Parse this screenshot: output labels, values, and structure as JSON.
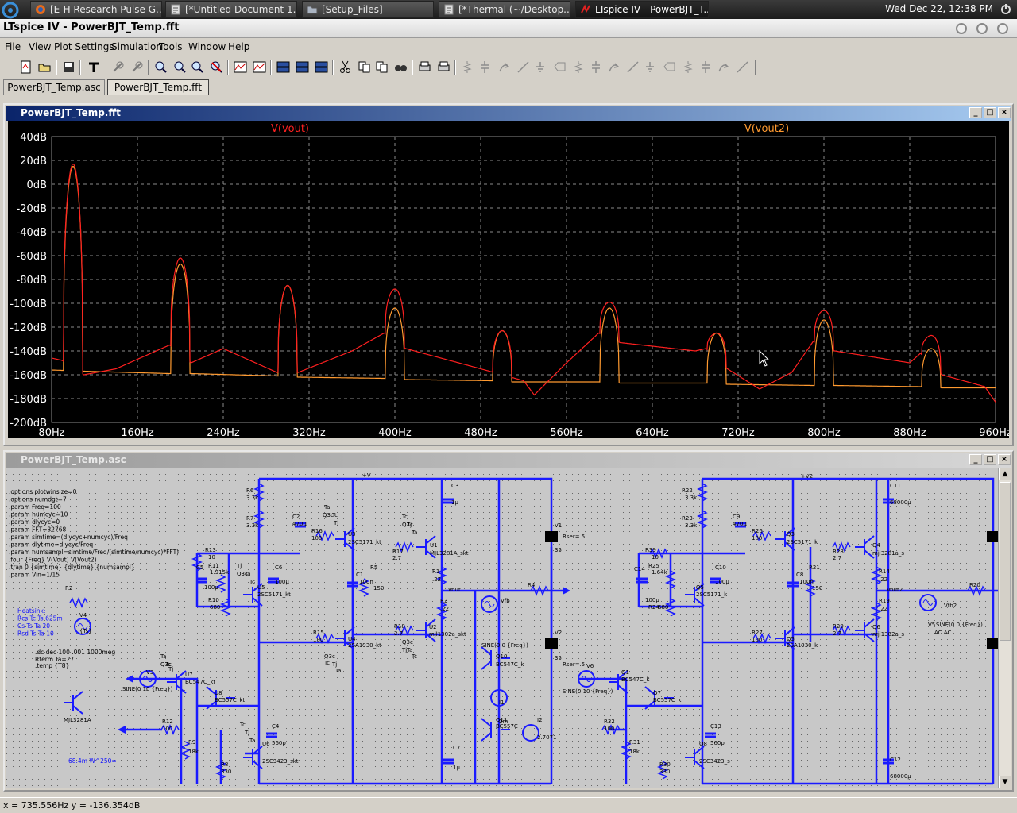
{
  "taskbar": {
    "tasks": [
      {
        "label": "[E-H Research Pulse G...",
        "icon": "firefox-icon"
      },
      {
        "label": "[*Untitled Document 1...",
        "icon": "text-editor-icon"
      },
      {
        "label": "[Setup_Files]",
        "icon": "folder-icon"
      },
      {
        "label": "[*Thermal (~/Desktop...",
        "icon": "text-editor-icon"
      },
      {
        "label": "LTspice IV - PowerBJT_T...",
        "icon": "ltspice-icon"
      }
    ],
    "clock": "Wed Dec 22, 12:38 PM"
  },
  "app": {
    "title": "LTspice IV - PowerBJT_Temp.fft"
  },
  "menu": [
    "File",
    "View",
    "Plot Settings",
    "Simulation",
    "Tools",
    "Window",
    "Help"
  ],
  "toolbar": {
    "buttons": [
      "new-schematic-icon",
      "open-icon",
      "save-icon",
      "control-panel-icon",
      "run-icon",
      "pan-icon",
      "zoom-in-icon",
      "zoom-fit-icon",
      "zoom-out-icon",
      "zoom-cancel-icon",
      "autorange-icon",
      "autorange-all-icon",
      "tile-horizontal-icon",
      "cascade-icon",
      "tile-windows-icon",
      "cut-icon",
      "copy-icon",
      "paste-icon",
      "find-icon",
      "print-setup-icon",
      "print-icon",
      "wire-icon",
      "ground-icon",
      "label-net-icon",
      "resistor-icon",
      "capacitor-icon",
      "inductor-icon",
      "diode-icon",
      "component-icon",
      "move-icon",
      "drag-icon",
      "undo-icon",
      "redo-icon",
      "rotate-icon",
      "mirror-icon",
      "text-icon",
      "spice-directive-icon"
    ]
  },
  "doc_tabs": [
    {
      "label": "PowerBJT_Temp.asc",
      "active": false
    },
    {
      "label": "PowerBJT_Temp.fft",
      "active": true
    }
  ],
  "plot_window": {
    "title": "PowerBJT_Temp.fft"
  },
  "schematic_window": {
    "title": "PowerBJT_Temp.asc"
  },
  "status": {
    "coords": "x = 735.556Hz    y = -136.354dB"
  },
  "colors": {
    "trace1": "#ff2020",
    "trace2": "#ff9a30",
    "wire": "#1a1aff",
    "grid": "#8a8a8a"
  },
  "chart_data": {
    "type": "line",
    "series": [
      {
        "name": "V(vout)",
        "color": "#ff2020",
        "peaks": [
          [
            100,
            17
          ],
          [
            200,
            -62
          ],
          [
            300,
            -85
          ],
          [
            400,
            -88
          ],
          [
            500,
            -123
          ],
          [
            600,
            -99
          ],
          [
            700,
            -125
          ],
          [
            800,
            -106
          ],
          [
            900,
            -127
          ]
        ],
        "floor": [
          [
            80,
            -146
          ],
          [
            90,
            -148
          ],
          [
            110,
            -160
          ],
          [
            140,
            -155
          ],
          [
            190,
            -135
          ],
          [
            210,
            -150
          ],
          [
            240,
            -138
          ],
          [
            290,
            -158
          ],
          [
            310,
            -158
          ],
          [
            360,
            -140
          ],
          [
            390,
            -125
          ],
          [
            410,
            -138
          ],
          [
            480,
            -155
          ],
          [
            520,
            -165
          ],
          [
            530,
            -177
          ],
          [
            560,
            -150
          ],
          [
            590,
            -125
          ],
          [
            610,
            -133
          ],
          [
            680,
            -140
          ],
          [
            690,
            -138
          ],
          [
            710,
            -155
          ],
          [
            740,
            -172
          ],
          [
            770,
            -158
          ],
          [
            790,
            -132
          ],
          [
            810,
            -140
          ],
          [
            880,
            -150
          ],
          [
            890,
            -142
          ],
          [
            910,
            -160
          ],
          [
            950,
            -170
          ],
          [
            960,
            -183
          ]
        ]
      },
      {
        "name": "V(vout2)",
        "color": "#ff9a30",
        "peaks": [
          [
            100,
            15
          ],
          [
            200,
            -67
          ],
          [
            300,
            -85
          ],
          [
            400,
            -104
          ],
          [
            500,
            -123
          ],
          [
            600,
            -104
          ],
          [
            700,
            -125
          ],
          [
            800,
            -114
          ],
          [
            900,
            -138
          ]
        ],
        "floor": [
          [
            80,
            -156
          ],
          [
            110,
            -157
          ],
          [
            190,
            -159
          ],
          [
            210,
            -159
          ],
          [
            290,
            -161
          ],
          [
            310,
            -162
          ],
          [
            390,
            -163
          ],
          [
            410,
            -164
          ],
          [
            490,
            -165
          ],
          [
            510,
            -166
          ],
          [
            590,
            -166
          ],
          [
            610,
            -167
          ],
          [
            690,
            -167
          ],
          [
            710,
            -168
          ],
          [
            790,
            -169
          ],
          [
            810,
            -169
          ],
          [
            890,
            -170
          ],
          [
            910,
            -171
          ],
          [
            950,
            -171
          ]
        ]
      }
    ],
    "xlabel": "",
    "ylabel": "",
    "xlim": [
      80,
      960
    ],
    "ylim": [
      -200,
      40
    ],
    "xticks": [
      "80Hz",
      "160Hz",
      "240Hz",
      "320Hz",
      "400Hz",
      "480Hz",
      "560Hz",
      "640Hz",
      "720Hz",
      "800Hz",
      "880Hz",
      "960Hz"
    ],
    "yticks": [
      "40dB",
      "20dB",
      "0dB",
      "-20dB",
      "-40dB",
      "-60dB",
      "-80dB",
      "-100dB",
      "-120dB",
      "-140dB",
      "-160dB",
      "-180dB",
      "-200dB"
    ],
    "grid": true
  },
  "schematic": {
    "directives": [
      ".options plotwinsize=0",
      ".options numdgt=7",
      ".param Freq=100",
      ".param numcyc=10",
      ".param dlycyc=0",
      ".param FFT=32768",
      ".param simtime=(dlycyc+numcyc)/Freq",
      ".param dlytime=dlycyc/Freq",
      ".param numsampl=simtime/Freq/(simtime/numcyc)*FFT)",
      ".four {Freq} V(Vout) V(Vout2)",
      ".tran 0 {simtime} {dlytime} {numsampl}",
      ".param Vin=1/15"
    ],
    "heatsink": [
      "Heatsink:",
      "Rcs Tc Ts 625m",
      "Cs Ts Ta 20",
      "Rsd Ts Ta 10"
    ],
    "misc": [
      ".dc dec 100 .001 1000meg",
      "Rterm Ta=27",
      ".temp {T8}",
      "68.4m W^250="
    ],
    "labels_left": [
      "R6",
      "3.3k",
      "R7",
      "3.3k",
      "C2",
      "470μ",
      "R16",
      "100",
      "R13",
      "10",
      "R11",
      "1.915k",
      "C5",
      "100μ",
      "R10",
      "680",
      "C6",
      "100μ",
      "U5",
      "2SC5171_kt",
      "U3",
      "2SC5171_kt",
      "R17",
      "2.7",
      "U1",
      "MJL3281A_skt",
      "R1",
      ".22",
      "Vout",
      "R4",
      "C1",
      "100n",
      "R5",
      "150",
      "R3",
      ".22",
      "R18",
      "2.7",
      "U2",
      "mjl1302a_skt",
      "U4",
      "2SA1930_kt",
      "R15",
      "100",
      "C3",
      "1μ",
      "V1",
      "35",
      "V2",
      "35",
      "Rser=.5",
      "R2",
      "R12",
      "100",
      "R9",
      "18k",
      "R8",
      "330",
      "U7",
      "BC547C_kt",
      "U8",
      "BC557C_kt",
      "U6",
      "2SC3423_skt",
      "C4",
      "560p",
      "C7",
      "1μ",
      "V3",
      "SINE(0 10 {Freq})",
      "V4",
      "{Ts}",
      "Q10",
      "BC547C_k",
      "Q11",
      "BC557C",
      "I1",
      "2m",
      "I2",
      "2.7071",
      "Vfb",
      "SINE(0 0 {Freq})",
      "MJL3281A"
    ],
    "labels_right": [
      "R22",
      "3.3k",
      "R23",
      "3.3k",
      "C9",
      "470μ",
      "R26",
      "100",
      "R39",
      "10",
      "R25",
      "1.64k",
      "C14",
      "100μ",
      "R24",
      "680",
      "C10",
      "100μ",
      "Q5",
      "2SC5171_k",
      "Q3",
      "2SC5171_k",
      "R28",
      "2.7",
      "Q4",
      "mjl3281a_s",
      "R14",
      ".22",
      "Vout2",
      "R20",
      "C8",
      "100n",
      "R21",
      "150",
      "R19",
      ".22",
      "R29",
      "2.7",
      "Q6",
      "mjl1302a_s",
      "Q5",
      "2SA1930_k",
      "R27",
      "100",
      "C11",
      "68000μ",
      "C12",
      "68000μ",
      "+V2",
      "Rser=.5",
      "R32",
      "100",
      "R31",
      "18k",
      "R30",
      "330",
      "Q1",
      "BC547C_k",
      "Q7",
      "BC557C_k",
      "Q8",
      "2SC3423_s",
      "C13",
      "560p",
      "V6",
      "SINE(0 10 {Freq})",
      "V5",
      "SINE(0 0 {Freq})",
      "Vfb2",
      "AC AC"
    ],
    "net_labels": [
      "+V",
      "-V",
      "Ta",
      "Tc",
      "Tj",
      "Q3c",
      "Q4c",
      "Q1c",
      "Q2c",
      "Ts"
    ]
  }
}
